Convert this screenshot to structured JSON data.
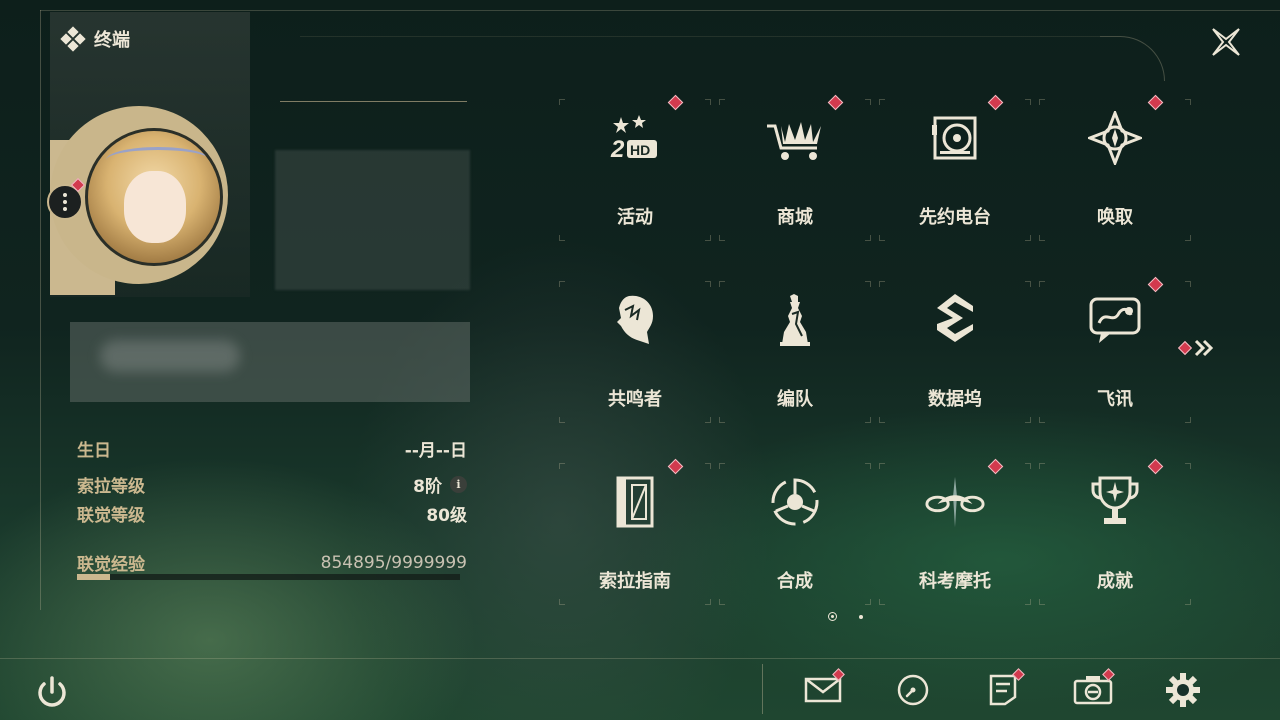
{
  "window": {
    "title": "终端"
  },
  "profile": {
    "birthday_label": "生日",
    "birthday_value": "--月--日",
    "sola_level_label": "索拉等级",
    "sola_level_value": "8阶",
    "union_level_label": "联觉等级",
    "union_level_value": "80级",
    "union_exp_label": "联觉经验",
    "union_exp_value": "854895/9999999",
    "union_exp_progress": 0.0855
  },
  "menu": {
    "items": [
      {
        "label": "活动",
        "icon": "events-icon",
        "badge": true
      },
      {
        "label": "商城",
        "icon": "shop-icon",
        "badge": true
      },
      {
        "label": "先约电台",
        "icon": "radio-icon",
        "badge": true
      },
      {
        "label": "唤取",
        "icon": "convene-icon",
        "badge": true
      },
      {
        "label": "共鸣者",
        "icon": "resonator-icon",
        "badge": false
      },
      {
        "label": "编队",
        "icon": "team-icon",
        "badge": false
      },
      {
        "label": "数据坞",
        "icon": "data-bank-icon",
        "badge": false
      },
      {
        "label": "飞讯",
        "icon": "message-icon",
        "badge": true
      },
      {
        "label": "索拉指南",
        "icon": "guidebook-icon",
        "badge": true
      },
      {
        "label": "合成",
        "icon": "synthesis-icon",
        "badge": false
      },
      {
        "label": "科考摩托",
        "icon": "motorbike-icon",
        "badge": true
      },
      {
        "label": "成就",
        "icon": "achievement-icon",
        "badge": true
      }
    ],
    "next_page_badge": true,
    "pages": 2,
    "current_page": 1
  },
  "bottom_bar": {
    "icons": [
      "power-icon",
      "mail-icon",
      "clock-icon",
      "notes-icon",
      "camera-icon",
      "settings-icon"
    ]
  },
  "colors": {
    "accent": "#cbb88f",
    "badge": "#d23a4e",
    "text": "#ece6d6"
  }
}
